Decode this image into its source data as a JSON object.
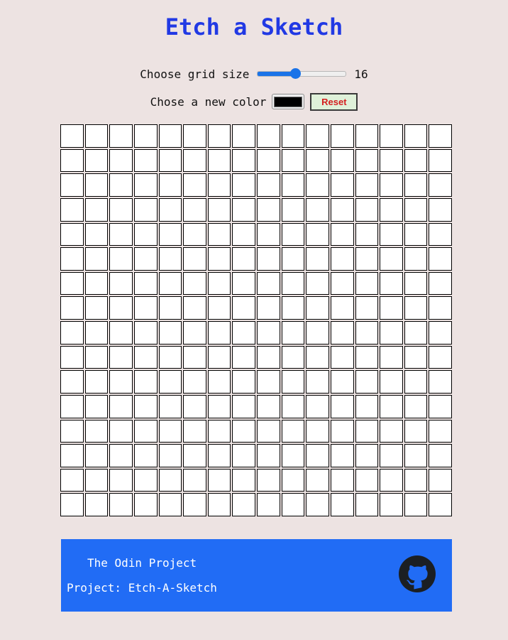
{
  "title": "Etch a Sketch",
  "controls": {
    "grid_size_label": "Choose grid size",
    "grid_size_value": "16",
    "grid_size_min": 2,
    "grid_size_max": 64,
    "color_label": "Chose a new color",
    "selected_color": "#000000",
    "reset_label": "Reset"
  },
  "grid": {
    "rows": 16,
    "cols": 16,
    "cell_color": "#ffffff"
  },
  "footer": {
    "line1": "The Odin Project",
    "line2": "Project: Etch-A-Sketch",
    "icon": "github-icon"
  },
  "colors": {
    "accent": "#2139e4",
    "footer_bg": "#216cf5",
    "slider": "#1a73e8",
    "reset_text": "#d41f1f",
    "reset_bg": "#dff1d9"
  }
}
